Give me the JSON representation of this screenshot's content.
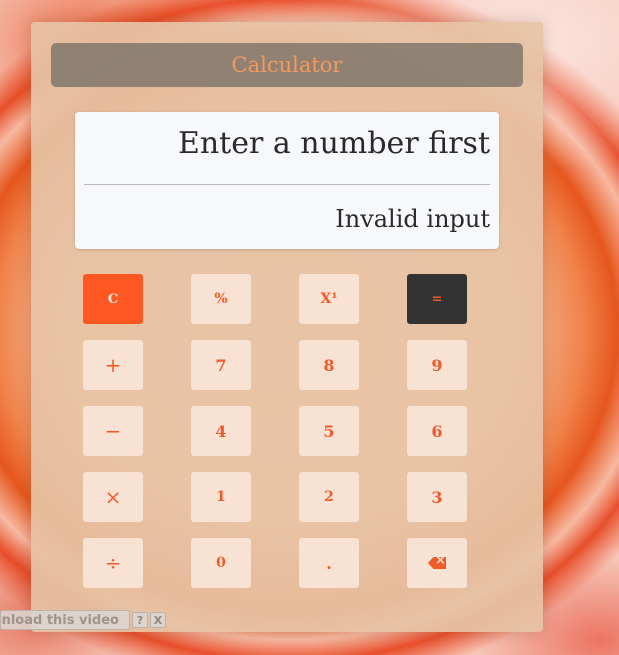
{
  "app": {
    "title": "Calculator"
  },
  "display": {
    "main_text": "Enter a number first",
    "sub_text": "Invalid input"
  },
  "keypad": {
    "rows": [
      [
        {
          "id": "clear",
          "label": "C",
          "icon": "clear-icon"
        },
        {
          "id": "percent",
          "label": "%",
          "icon": "percent-icon"
        },
        {
          "id": "power",
          "label": "X¹",
          "icon": "power-icon"
        },
        {
          "id": "equals",
          "label": "=",
          "icon": "equals-icon"
        }
      ],
      [
        {
          "id": "plus",
          "label": "+",
          "icon": "plus-icon"
        },
        {
          "id": "7",
          "label": "7"
        },
        {
          "id": "8",
          "label": "8"
        },
        {
          "id": "9",
          "label": "9"
        }
      ],
      [
        {
          "id": "minus",
          "label": "−",
          "icon": "minus-icon"
        },
        {
          "id": "4",
          "label": "4"
        },
        {
          "id": "5",
          "label": "5"
        },
        {
          "id": "6",
          "label": "6"
        }
      ],
      [
        {
          "id": "multiply",
          "label": "×",
          "icon": "multiply-icon"
        },
        {
          "id": "1",
          "label": "1"
        },
        {
          "id": "2",
          "label": "2"
        },
        {
          "id": "3",
          "label": "3"
        }
      ],
      [
        {
          "id": "divide",
          "label": "÷",
          "icon": "divide-icon"
        },
        {
          "id": "0",
          "label": "0"
        },
        {
          "id": "decimal",
          "label": "."
        },
        {
          "id": "backspace",
          "label": "",
          "icon": "backspace-icon"
        }
      ]
    ]
  },
  "download_bar": {
    "label": "ynload this video",
    "help_label": "?",
    "close_label": "X"
  },
  "colors": {
    "accent": "#f15b2a",
    "clear_key": "#ff5722",
    "equals_key": "#333333",
    "key_bg": "#f7e2d4",
    "title_text": "#f39a5c"
  }
}
